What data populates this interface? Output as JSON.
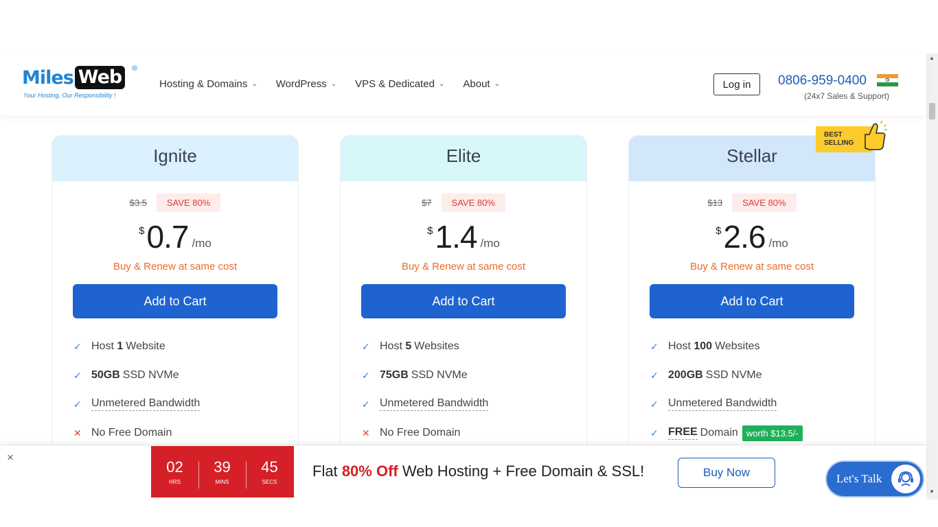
{
  "header": {
    "logo": {
      "miles": "Miles",
      "web": "Web",
      "reg": "®",
      "tagline": "Your Hosting, Our Responsibility !"
    },
    "nav": [
      {
        "label": "Hosting & Domains"
      },
      {
        "label": "WordPress"
      },
      {
        "label": "VPS & Dedicated"
      },
      {
        "label": "About"
      }
    ],
    "login_label": "Log in",
    "phone": "0806-959-0400",
    "support_text": "(24x7 Sales & Support)"
  },
  "best_selling": {
    "line1": "BEST",
    "line2": "SELLING"
  },
  "plans": [
    {
      "name": "Ignite",
      "old_price": "$3.5",
      "save": "SAVE 80%",
      "currency": "$",
      "price": "0.7",
      "period": "/mo",
      "renew": "Buy & Renew at same cost",
      "cta": "Add to Cart",
      "features": [
        {
          "pre": "Host",
          "bold": "1",
          "post": "Website"
        },
        {
          "bold": "50GB",
          "post": "SSD NVMe"
        },
        {
          "text": "Unmetered Bandwidth"
        },
        {
          "text": "No Free Domain"
        }
      ]
    },
    {
      "name": "Elite",
      "old_price": "$7",
      "save": "SAVE 80%",
      "currency": "$",
      "price": "1.4",
      "period": "/mo",
      "renew": "Buy & Renew at same cost",
      "cta": "Add to Cart",
      "features": [
        {
          "pre": "Host",
          "bold": "5",
          "post": "Websites"
        },
        {
          "bold": "75GB",
          "post": "SSD NVMe"
        },
        {
          "text": "Unmetered Bandwidth"
        },
        {
          "text": "No Free Domain"
        }
      ]
    },
    {
      "name": "Stellar",
      "old_price": "$13",
      "save": "SAVE 80%",
      "currency": "$",
      "price": "2.6",
      "period": "/mo",
      "renew": "Buy & Renew at same cost",
      "cta": "Add to Cart",
      "features": [
        {
          "pre": "Host",
          "bold": "100",
          "post": "Websites"
        },
        {
          "bold": "200GB",
          "post": "SSD NVMe"
        },
        {
          "text": "Unmetered Bandwidth"
        },
        {
          "bold": "FREE",
          "post": "Domain",
          "badge": "worth $13.5/-"
        }
      ]
    }
  ],
  "promo": {
    "close": "×",
    "timer": [
      {
        "num": "02",
        "label": "HRS"
      },
      {
        "num": "39",
        "label": "MINS"
      },
      {
        "num": "45",
        "label": "SECS"
      }
    ],
    "text_pre": "Flat",
    "text_highlight": "80% Off",
    "text_post": "Web Hosting + Free Domain & SSL!",
    "buy_now": "Buy Now",
    "lets_talk": "Let's Talk"
  },
  "colors": {
    "brand_blue": "#1f63d0",
    "accent_red": "#d52027",
    "renew_orange": "#e86b2c",
    "worth_green": "#1fb05a"
  }
}
